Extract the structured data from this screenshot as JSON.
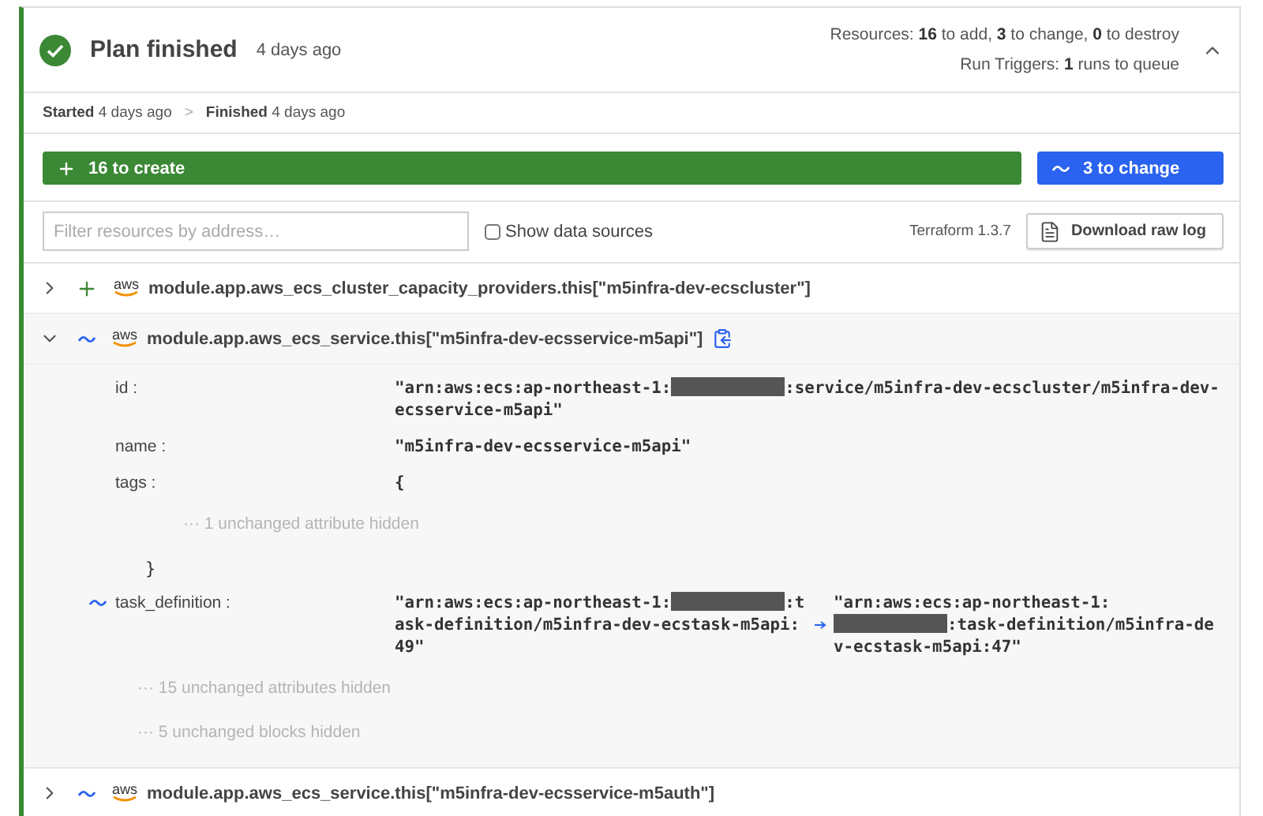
{
  "header": {
    "status": "Plan finished",
    "time": "4 days ago",
    "expanded": true,
    "summary": [
      "Resources: **16** to add, **3** to change, **0** to destroy",
      "Run Triggers: **1** runs to queue"
    ]
  },
  "timeline": {
    "separator": ">",
    "steps": [
      {
        "label": "Started",
        "time": "4 days ago"
      },
      {
        "label": "Finished",
        "time": "4 days ago"
      }
    ]
  },
  "bars": [
    {
      "kind": "create",
      "label": "16 to create"
    },
    {
      "kind": "change",
      "label": "3 to change"
    }
  ],
  "toolbar": {
    "filter": {
      "placeholder": "Filter resources by address…"
    },
    "data_sources": {
      "label": "Show data sources",
      "checked": false
    },
    "version": "Terraform 1.3.7",
    "download": "Download raw log"
  },
  "resources": [
    {
      "kind": "create",
      "provider": "aws",
      "address": "module.app.aws_ecs_cluster_capacity_providers.this[\"m5infra-dev-ecscluster\"]",
      "expanded": false
    },
    {
      "kind": "update",
      "provider": "aws",
      "address": "module.app.aws_ecs_service.this[\"m5infra-dev-ecsservice-m5api\"]",
      "expanded": true,
      "attributes": [
        {
          "kind": "value",
          "name": "id :",
          "value": [
            {
              "kind": "text",
              "text": "\"arn:aws:ecs:ap-northeast-1:"
            },
            {
              "kind": "redacted"
            },
            {
              "kind": "text",
              "text": ":service/m5infra-dev-ecscluster/m5infra-dev-ecsservice-m5api\""
            }
          ]
        },
        {
          "kind": "value",
          "name": "name :",
          "value": [
            {
              "kind": "text",
              "text": "\"m5infra-dev-ecsservice-m5api\""
            }
          ]
        },
        {
          "kind": "open",
          "name": "tags :",
          "brace": "{"
        },
        {
          "kind": "hidden",
          "nested": true,
          "text": "··· 1 unchanged attribute hidden"
        },
        {
          "kind": "close",
          "brace": "}"
        },
        {
          "kind": "change",
          "name": "task_definition :",
          "value": [
            {
              "kind": "text",
              "text": "\"arn:aws:ecs:ap-northeast-1:"
            },
            {
              "kind": "redacted"
            },
            {
              "kind": "text",
              "text": ":task-definition/m5infra-dev-ecstask-m5api:49\""
            }
          ],
          "new_value": [
            {
              "kind": "text",
              "text": "\"arn:aws:ecs:ap-northeast-1:"
            },
            {
              "kind": "redacted"
            },
            {
              "kind": "text",
              "text": ":task-definition/m5infra-dev-ecstask-m5api:47\""
            }
          ]
        },
        {
          "kind": "hidden",
          "nested": false,
          "text": "··· 15 unchanged attributes hidden"
        },
        {
          "kind": "hidden",
          "nested": false,
          "text": "··· 5 unchanged blocks hidden"
        }
      ]
    },
    {
      "kind": "update",
      "provider": "aws",
      "address": "module.app.aws_ecs_service.this[\"m5infra-dev-ecsservice-m5auth\"]",
      "expanded": false
    }
  ]
}
